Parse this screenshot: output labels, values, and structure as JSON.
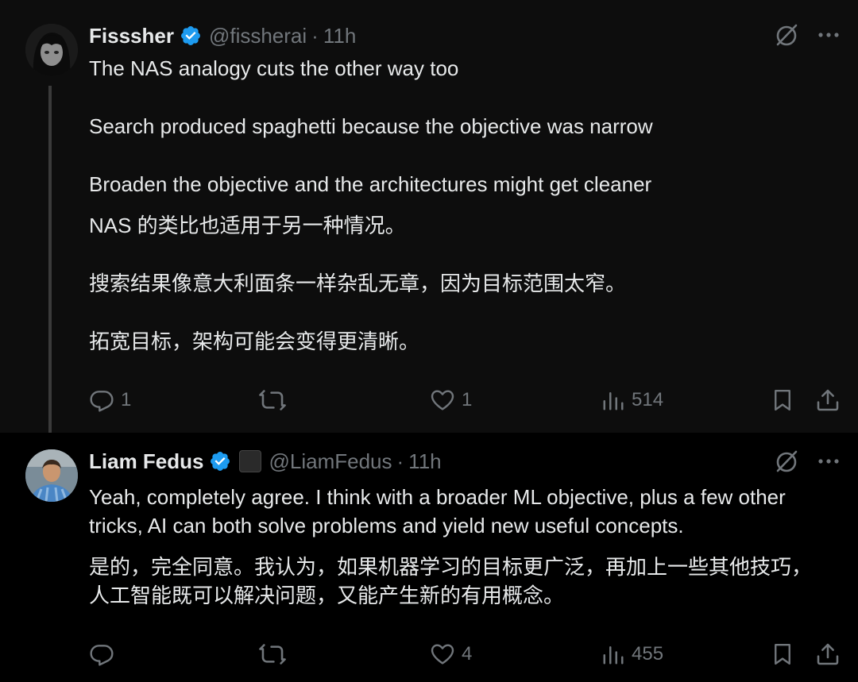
{
  "tweets": [
    {
      "author": {
        "name": "Fisssher",
        "handle": "@fissherai",
        "time": "11h",
        "verified": true
      },
      "paragraphs": [
        "The NAS analogy cuts the other way too",
        "Search produced spaghetti because the objective was narrow",
        "Broaden the objective and the architectures might get cleaner",
        "NAS 的类比也适用于另一种情况。",
        "搜索结果像意大利面条一样杂乱无章，因为目标范围太窄。",
        "拓宽目标，架构可能会变得更清晰。"
      ],
      "stats": {
        "replies": "1",
        "retweets": "",
        "likes": "1",
        "views": "514"
      }
    },
    {
      "author": {
        "name": "Liam Fedus",
        "handle": "@LiamFedus",
        "time": "11h",
        "verified": true
      },
      "paragraphs": [
        "Yeah, completely agree. I think with a broader ML objective, plus a few other tricks, AI can both solve problems and yield new useful concepts.",
        "是的，完全同意。我认为，如果机器学习的目标更广泛，再加上一些其他技巧，人工智能既可以解决问题，又能产生新的有用概念。"
      ],
      "stats": {
        "replies": "",
        "retweets": "",
        "likes": "4",
        "views": "455"
      }
    }
  ],
  "colors": {
    "verified": "#1d9bf0",
    "muted": "#71767b",
    "text": "#e7e9ea"
  },
  "icons": [
    "verified-badge-icon",
    "grok-icon",
    "more-icon",
    "reply-icon",
    "retweet-icon",
    "like-icon",
    "views-icon",
    "bookmark-icon",
    "share-icon"
  ],
  "separator": "·"
}
